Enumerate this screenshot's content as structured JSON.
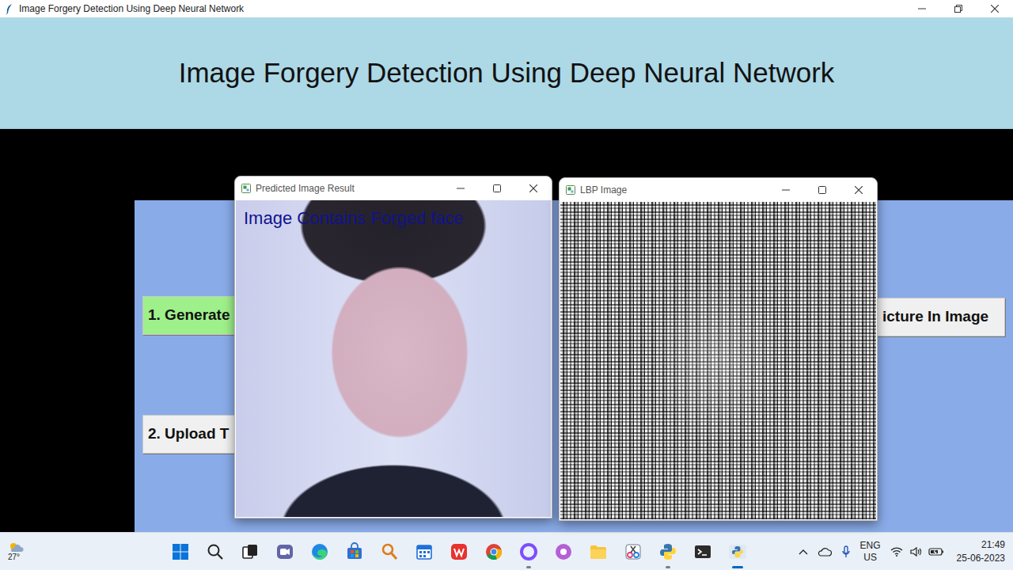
{
  "window": {
    "title": "Image Forgery Detection Using Deep Neural Network"
  },
  "header": {
    "title": "Image Forgery Detection Using Deep Neural Network"
  },
  "left_buttons": [
    {
      "label": "1. Generate",
      "color": "#9ef08a"
    },
    {
      "label": "2. Upload T",
      "color": "#f0f0f0"
    }
  ],
  "right_buttons": [
    {
      "label": "icture In Image",
      "color": "#f0f0f0"
    }
  ],
  "result_windows": [
    {
      "title": "Predicted Image Result",
      "kind": "photo",
      "overlay": "Image Contains Forged face"
    },
    {
      "title": "LBP Image",
      "kind": "lbp"
    }
  ],
  "taskbar": {
    "weather": "27°",
    "apps": [
      {
        "kind": "start",
        "running": false
      },
      {
        "kind": "search",
        "running": false
      },
      {
        "kind": "taskview",
        "running": false
      },
      {
        "kind": "teams",
        "running": false
      },
      {
        "kind": "edge",
        "running": false
      },
      {
        "kind": "store",
        "running": false
      },
      {
        "kind": "finder",
        "running": false
      },
      {
        "kind": "calendar",
        "running": false
      },
      {
        "kind": "wps",
        "running": false
      },
      {
        "kind": "chrome",
        "running": false
      },
      {
        "kind": "ring",
        "running": true
      },
      {
        "kind": "violet",
        "running": false
      },
      {
        "kind": "explorer",
        "running": false
      },
      {
        "kind": "snip",
        "running": false
      },
      {
        "kind": "python",
        "running": true
      },
      {
        "kind": "terminal",
        "running": false
      },
      {
        "kind": "pyactive",
        "running": true
      }
    ],
    "language": {
      "line1": "ENG",
      "line2": "US"
    },
    "time": "21:49",
    "date": "25-06-2023"
  }
}
